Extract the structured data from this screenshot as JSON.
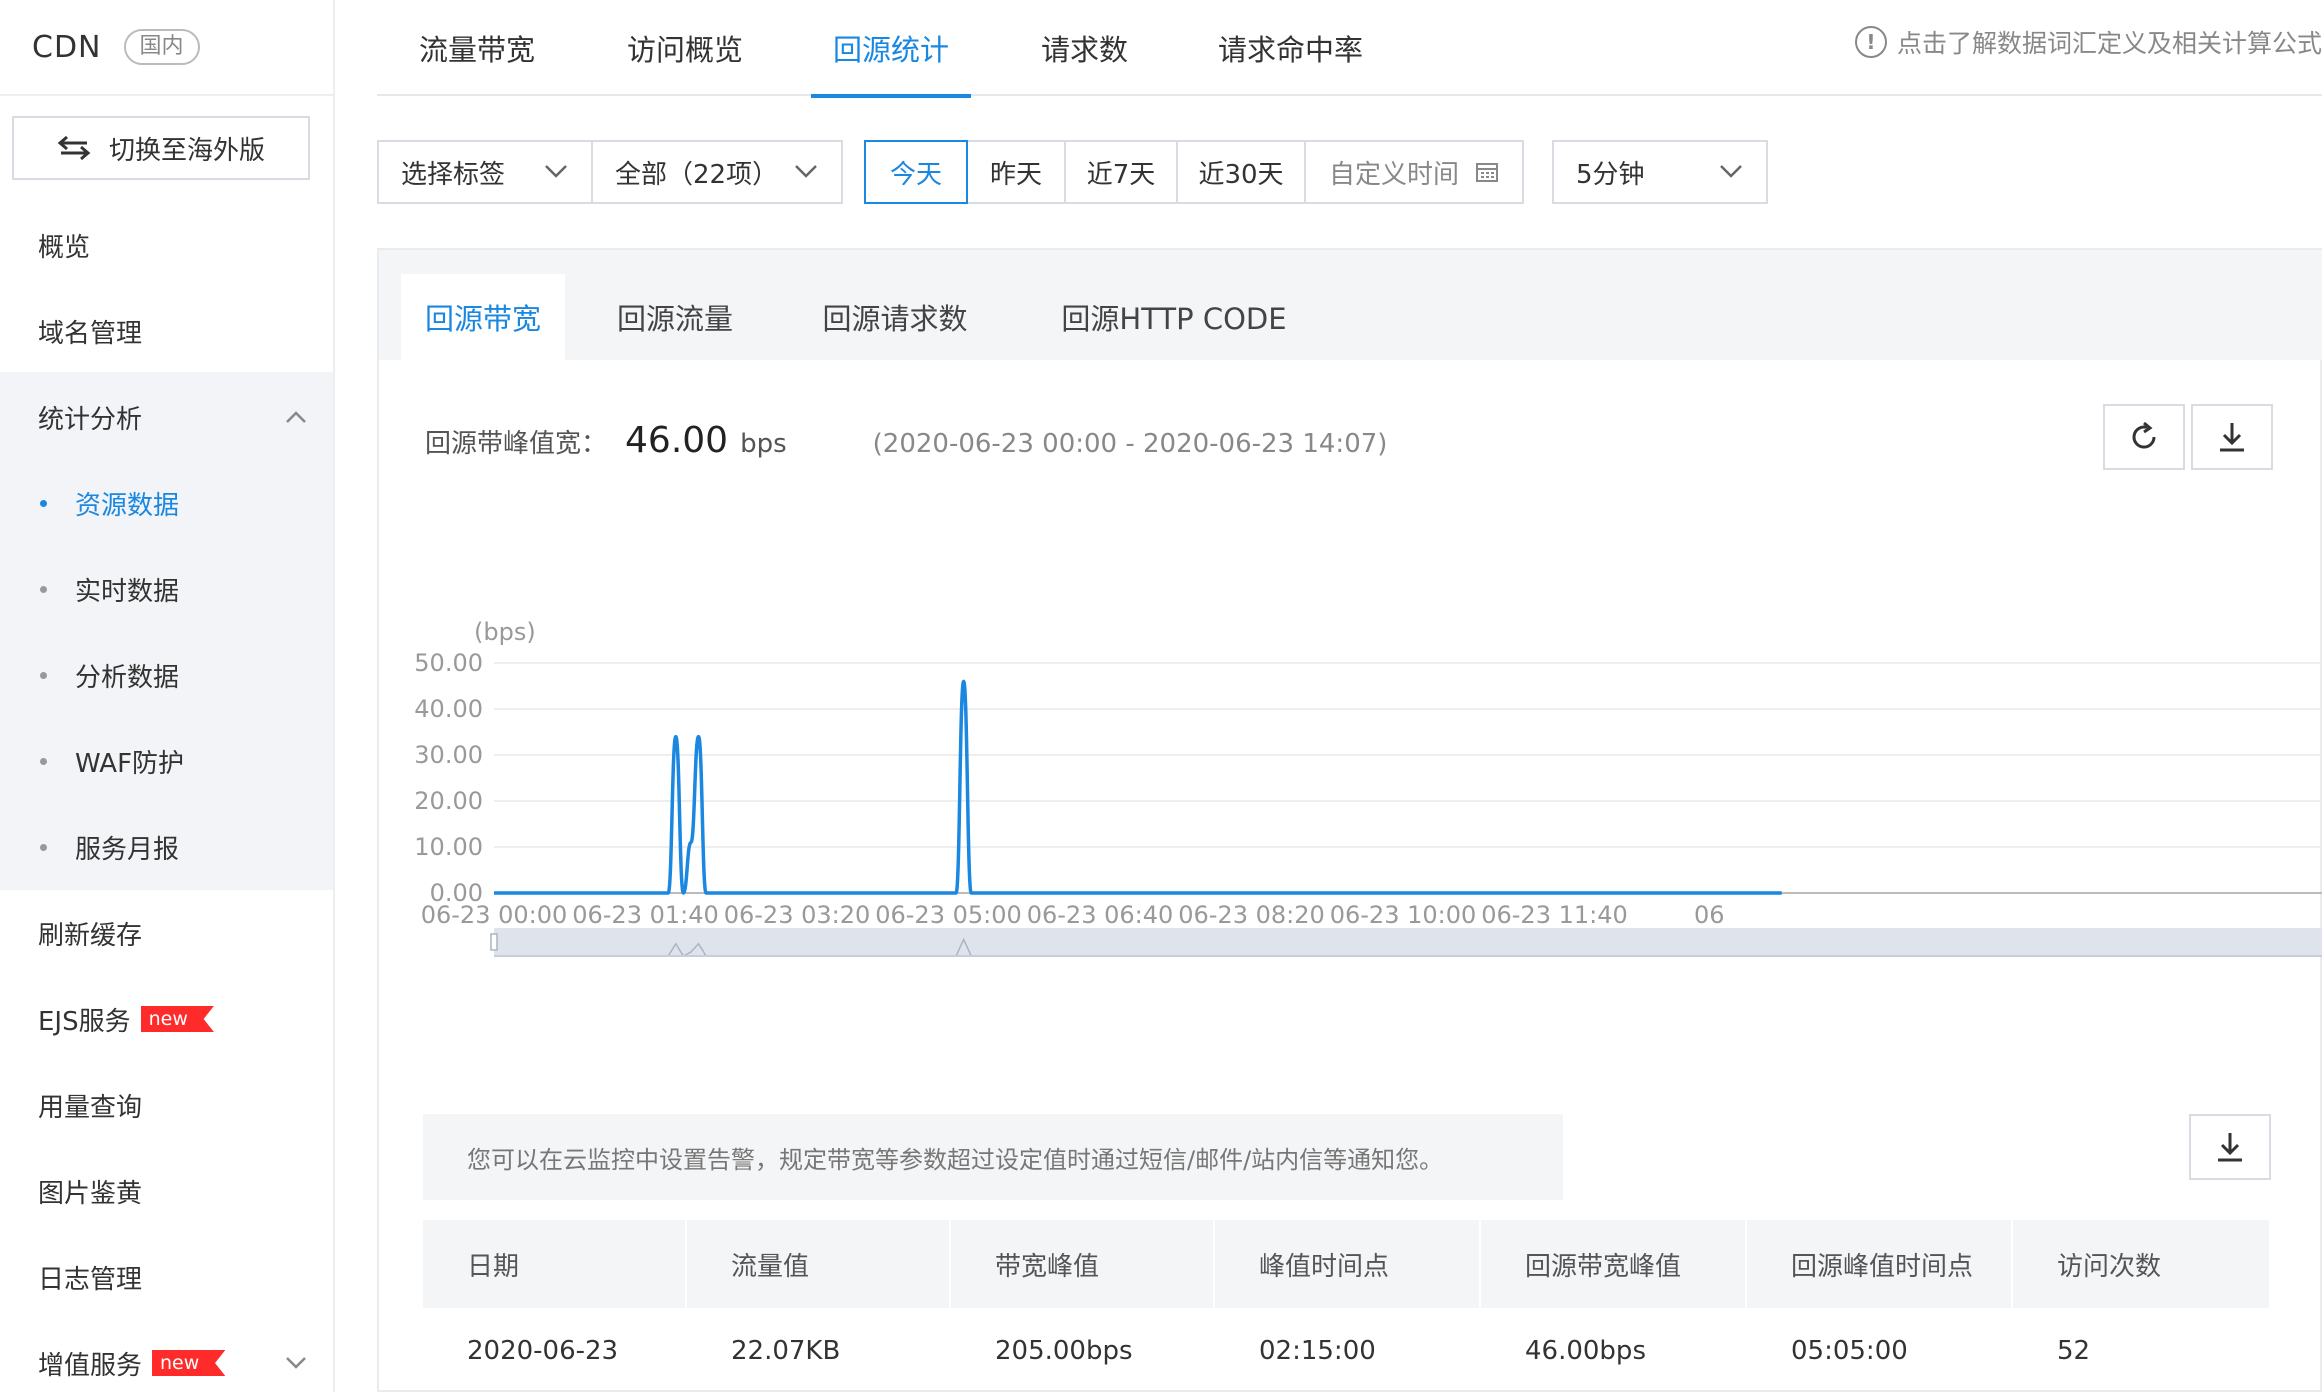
{
  "sidebar": {
    "title": "CDN",
    "region": "国内",
    "switch_label": "切换至海外版",
    "items": {
      "overview": "概览",
      "domain": "域名管理",
      "stats": "统计分析",
      "refresh": "刷新缓存",
      "ejs": "EJS服务",
      "usage": "用量查询",
      "image_review": "图片鉴黄",
      "logs": "日志管理",
      "value_added": "增值服务"
    },
    "new_badge": "new",
    "stats_children": [
      "资源数据",
      "实时数据",
      "分析数据",
      "WAF防护",
      "服务月报"
    ]
  },
  "top_tabs": [
    "流量带宽",
    "访问概览",
    "回源统计",
    "请求数",
    "请求命中率"
  ],
  "hint_text": "点击了解数据词汇定义及相关计算公式",
  "filters": {
    "tag_select": "选择标签",
    "domain_select": "全部（22项）",
    "time_ranges": [
      "今天",
      "昨天",
      "近7天",
      "近30天"
    ],
    "custom_time": "自定义时间",
    "granularity": "5分钟"
  },
  "sub_tabs": [
    "回源带宽",
    "回源流量",
    "回源请求数",
    "回源HTTP CODE"
  ],
  "peak": {
    "label": "回源带峰值宽：",
    "value": "46.00",
    "unit": "bps",
    "range": "(2020-06-23 00:00 - 2020-06-23 14:07)"
  },
  "chart_data": {
    "type": "line",
    "ylabel": "(bps)",
    "ylim": [
      0,
      50
    ],
    "yticks": [
      "50.00",
      "40.00",
      "30.00",
      "20.00",
      "10.00",
      "0.00"
    ],
    "xticks": [
      "06-23 00:00",
      "06-23 01:40",
      "06-23 03:20",
      "06-23 05:00",
      "06-23 06:40",
      "06-23 08:20",
      "06-23 10:00",
      "06-23 11:40",
      "06"
    ],
    "x_minutes": [
      0,
      110,
      115,
      120,
      125,
      130,
      135,
      140,
      145,
      150,
      300,
      305,
      310,
      315,
      320,
      850
    ],
    "values": [
      0,
      0,
      0,
      34,
      0,
      11,
      34,
      0,
      0,
      0,
      0,
      0,
      46,
      0,
      0,
      0
    ],
    "series_color": "#1a87e0"
  },
  "notice": "您可以在云监控中设置告警，规定带宽等参数超过设定值时通过短信/邮件/站内信等通知您。",
  "table": {
    "headers": [
      "日期",
      "流量值",
      "带宽峰值",
      "峰值时间点",
      "回源带宽峰值",
      "回源峰值时间点",
      "访问次数"
    ],
    "rows": [
      [
        "2020-06-23",
        "22.07KB",
        "205.00bps",
        "02:15:00",
        "46.00bps",
        "05:05:00",
        "52"
      ]
    ]
  },
  "colors": {
    "accent": "#1a87e0",
    "badge": "#ff2a2a"
  }
}
